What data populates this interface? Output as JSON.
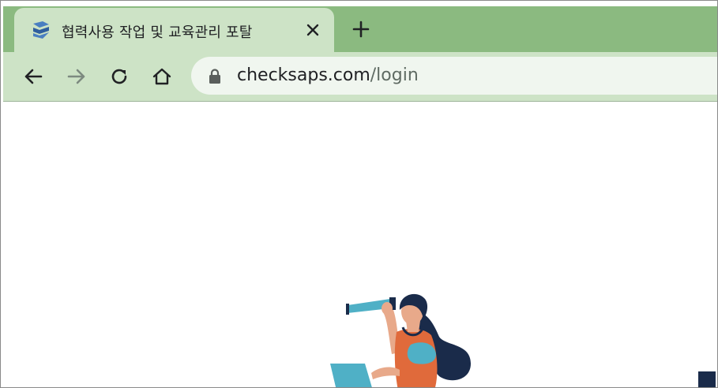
{
  "tab": {
    "title": "협력사용 작업 및 교육관리 포탈",
    "favicon": "checksaps-logo-icon",
    "close_icon": "close-icon"
  },
  "toolbar": {
    "new_tab_icon": "plus-icon",
    "back_icon": "arrow-left-icon",
    "forward_icon": "arrow-right-icon",
    "reload_icon": "reload-icon",
    "home_icon": "home-icon"
  },
  "address_bar": {
    "lock_icon": "lock-icon",
    "host": "checksaps.com",
    "path": "/login"
  },
  "colors": {
    "tabstrip": "#8bba80",
    "toolbar": "#cde3c6",
    "omnibox": "#f0f6ef",
    "navy": "#1a2b4a",
    "teal": "#4fb0c6",
    "orange": "#e06a3b"
  }
}
